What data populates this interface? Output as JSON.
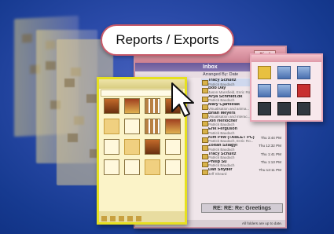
{
  "callout": {
    "label": "Reports / Exports"
  },
  "inbox": {
    "title": "Inbox",
    "arranged_by": "Arranged By: Date",
    "find_label": "Find",
    "messages": [
      {
        "name": "Tracy Schultz",
        "sub": "Patrick Baudach",
        "time": ""
      },
      {
        "name": "Bob Day",
        "sub": "Jason Mansfield, Enric Ro...",
        "time": ""
      },
      {
        "name": "Arya Schmidt.dk",
        "sub": "Patrick Baudach",
        "time": ""
      },
      {
        "name": "Mary Cjamielak",
        "sub": "Visualisation and anima...",
        "time": ""
      },
      {
        "name": "Brian Meyers",
        "sub": "Visualisation and interac...",
        "time": ""
      },
      {
        "name": "Jon Herlocher",
        "sub": "Patrick Baudach",
        "time": ""
      },
      {
        "name": "Erik Ferguson",
        "sub": "Patrick Baudach",
        "time": ""
      },
      {
        "name": "Kim Pew (TABLET PC)",
        "sub": "Patrick Baudach, Enric Ro...",
        "time": "Thu 3:44 PM"
      },
      {
        "name": "Zoltan Szlagyi",
        "sub": "Patrick Baudach",
        "time": "Thu 12:32 PM"
      },
      {
        "name": "Tracy Schultz",
        "sub": "Patrick Baudach",
        "time": "Thu 1:41 PM"
      },
      {
        "name": "Philip Su",
        "sub": "Patrick Baudach",
        "time": "Thu 1:13 PM"
      },
      {
        "name": "Dan Snyder",
        "sub": "Jeff Sheard",
        "time": "Thu 12:11 PM"
      }
    ],
    "folders": [
      "Rv Mail",
      "Flagged",
      "Sent",
      "Outbox",
      "Review",
      "Tools",
      "IE James",
      "IE David",
      "IE Tucker"
    ],
    "subject": "RE: RE: Re: Greetings",
    "status_left": "28 Items",
    "status_right": "All folders are up to date.",
    "status_far": "Connected to Mi..."
  },
  "icons": {
    "cursor": "pointer-arrow-icon"
  }
}
